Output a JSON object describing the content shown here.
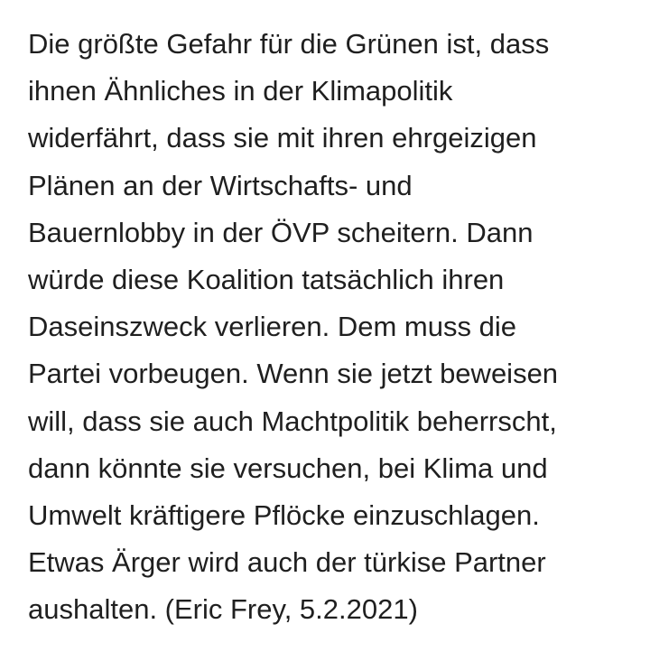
{
  "article": {
    "lines": [
      "Die größte Gefahr für die Grünen ist, dass",
      "ihnen Ähnliches in der Klimapolitik",
      "widerfährt, dass sie mit ihren ehrgeizigen",
      "Plänen an der Wirtschafts- und",
      "Bauernlobby in der ÖVP scheitern. Dann",
      "würde diese Koalition tatsächlich ihren",
      "Daseinszweck verlieren. Dem muss die",
      "Partei vorbeugen. Wenn sie jetzt beweisen",
      "will, dass sie auch Machtpolitik beherrscht,",
      "dann könnte sie versuchen, bei Klima und",
      "Umwelt kräftigere Pflöcke einzuschlagen.",
      "Etwas Ärger wird auch der türkise Partner",
      "aushalten. (Eric Frey, 5.2.2021)"
    ]
  }
}
